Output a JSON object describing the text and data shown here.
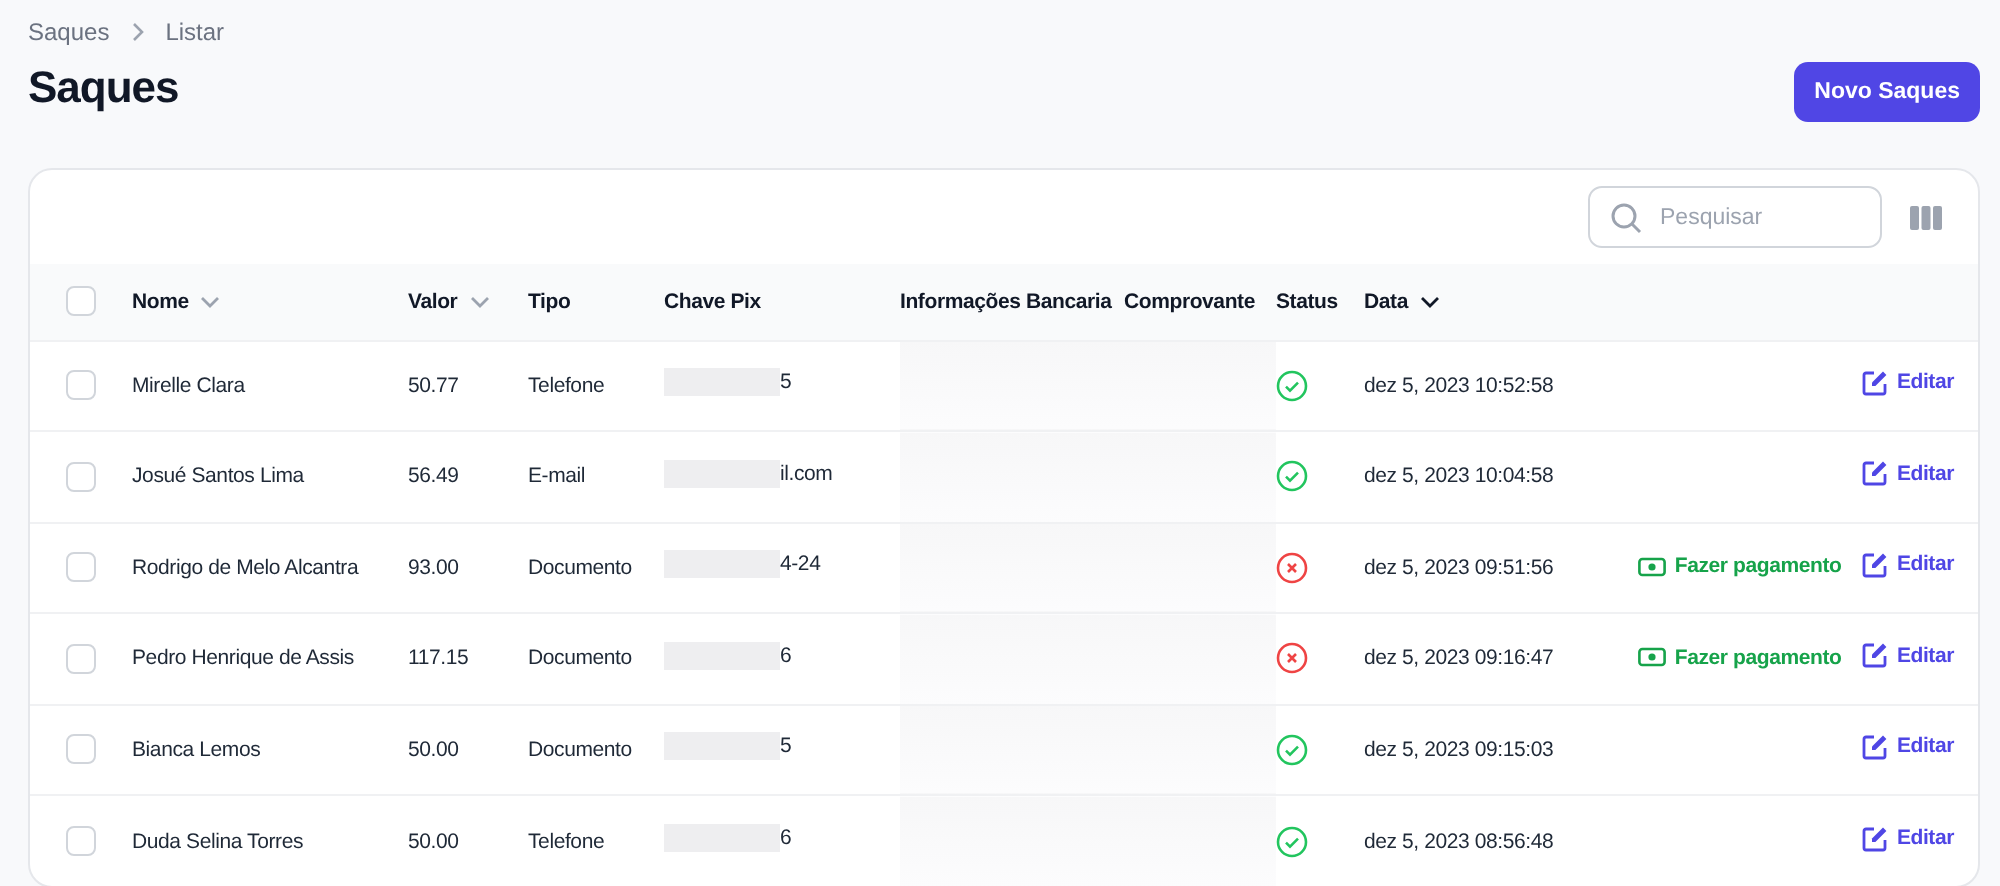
{
  "breadcrumbs": [
    "Saques",
    "Listar"
  ],
  "title": "Saques",
  "new_button": "Novo Saques",
  "search": {
    "placeholder": "Pesquisar"
  },
  "select_all": {
    "checked": false
  },
  "columns": [
    {
      "label": "Nome",
      "kind": "sortable"
    },
    {
      "label": "Valor",
      "kind": "sortable"
    },
    {
      "label": "Tipo",
      "kind": "plain"
    },
    {
      "label": "Chave Pix",
      "kind": "plain"
    },
    {
      "label": "Informações Bancaria",
      "kind": "plain"
    },
    {
      "label": "Comprovante",
      "kind": "plain"
    },
    {
      "label": "Status",
      "kind": "plain"
    },
    {
      "label": "Data",
      "kind": "sorted"
    }
  ],
  "rows": [
    {
      "nome": "Mirelle Clara",
      "valor": "50.77",
      "tipo": "Telefone",
      "chave": "5",
      "paid": true,
      "data": "dez 5, 2023 10:52:58",
      "edit": "Editar",
      "checked": false
    },
    {
      "nome": "Josué Santos Lima",
      "valor": "56.49",
      "tipo": "E-mail",
      "chave": "il.com",
      "paid": true,
      "data": "dez 5, 2023 10:04:58",
      "edit": "Editar",
      "checked": false
    },
    {
      "nome": "Rodrigo de Melo Alcantra",
      "valor": "93.00",
      "tipo": "Documento",
      "chave": "4-24",
      "paid": false,
      "data": "dez 5, 2023 09:51:56",
      "pay": "Fazer pagamento",
      "edit": "Editar",
      "checked": false
    },
    {
      "nome": "Pedro Henrique de Assis",
      "valor": "117.15",
      "tipo": "Documento",
      "chave": "6",
      "paid": false,
      "data": "dez 5, 2023 09:16:47",
      "pay": "Fazer pagamento",
      "edit": "Editar",
      "checked": false
    },
    {
      "nome": "Bianca Lemos",
      "valor": "50.00",
      "tipo": "Documento",
      "chave": "5",
      "paid": true,
      "data": "dez 5, 2023 09:15:03",
      "edit": "Editar",
      "checked": false
    },
    {
      "nome": "Duda Selina Torres",
      "valor": "50.00",
      "tipo": "Telefone",
      "chave": "6",
      "paid": true,
      "data": "dez 5, 2023 08:56:48",
      "edit": "Editar",
      "checked": false
    }
  ]
}
